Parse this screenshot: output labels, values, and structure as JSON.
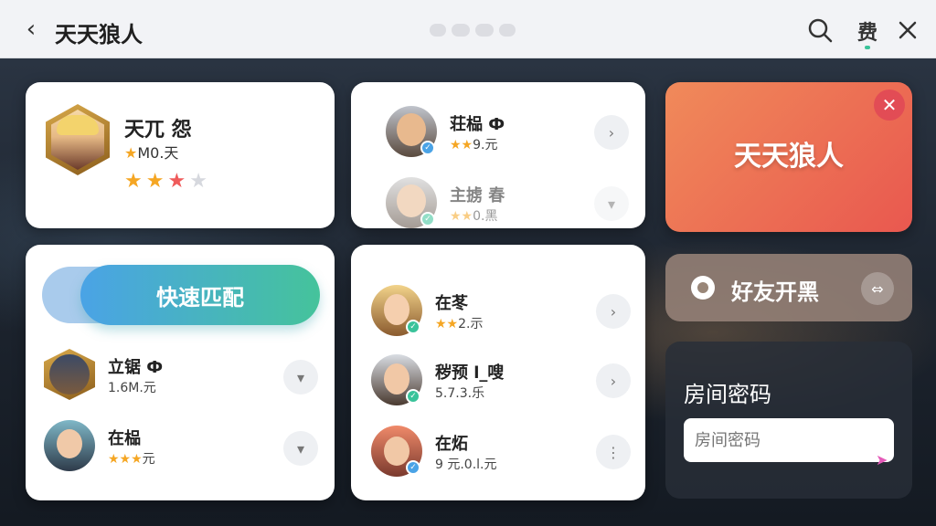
{
  "header": {
    "title": "天天狼人",
    "more_label": "费"
  },
  "profile": {
    "name": "天兀 怨",
    "level": "M0.天"
  },
  "match": {
    "quick_match_label": "快速匹配",
    "players": [
      {
        "name": "立锯 Ф",
        "sub": "1.6M.元"
      },
      {
        "name": "在榀",
        "sub": "元"
      }
    ]
  },
  "friends_top": [
    {
      "name": "荘榀 Ф",
      "sub": "9.元"
    },
    {
      "name": "主掳 春",
      "sub": "0.黑"
    }
  ],
  "friends_main": [
    {
      "name": "在苳",
      "sub": "2.示"
    },
    {
      "name": "秽预 l_嗖",
      "sub": "5.7.3.乐"
    },
    {
      "name": "在炻",
      "sub": "9 元.0.l.元"
    }
  ],
  "game_tile": {
    "name": "天天狼人"
  },
  "friends_play": {
    "label": "好友开黑"
  },
  "room": {
    "title": "房间密码",
    "placeholder": "房间密码"
  },
  "colors": {
    "accent_blue": "#4aa3e6",
    "accent_green": "#3ac39a",
    "game_tile": "#e9584f",
    "star": "#f5a623"
  }
}
